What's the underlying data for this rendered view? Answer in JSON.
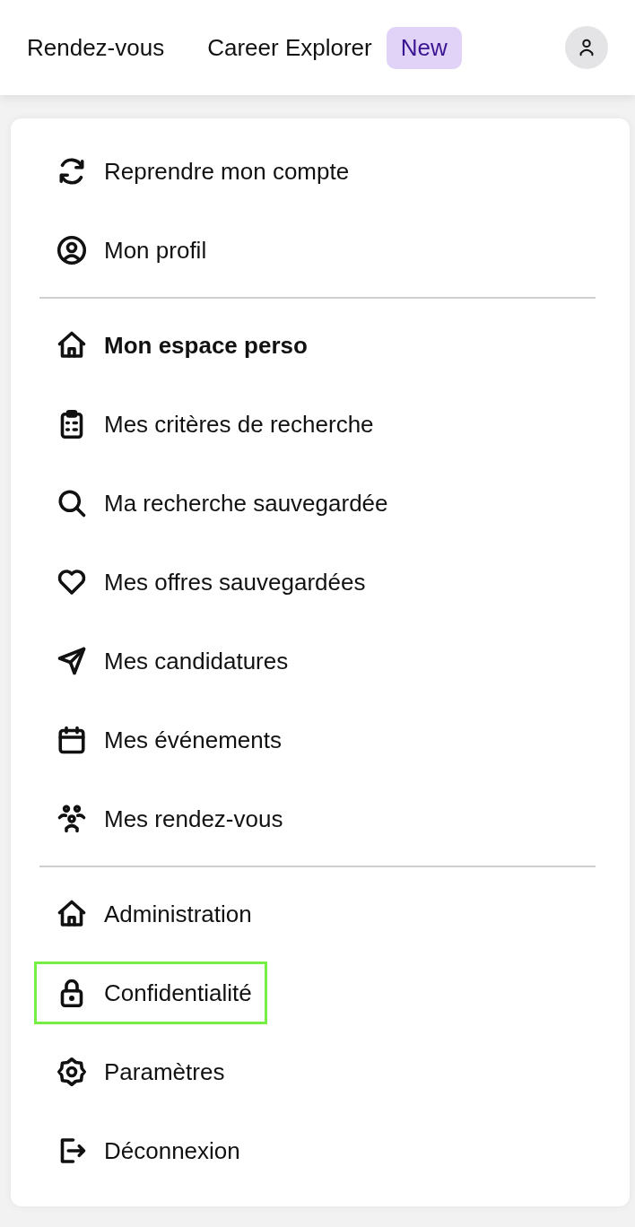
{
  "header": {
    "links": [
      {
        "label": "Rendez-vous"
      },
      {
        "label": "Career Explorer",
        "badge": "New"
      }
    ]
  },
  "menu": {
    "sections": [
      {
        "items": [
          {
            "label": "Reprendre mon compte",
            "bold": false,
            "selected": false
          },
          {
            "label": "Mon profil",
            "bold": false,
            "selected": false
          }
        ]
      },
      {
        "items": [
          {
            "label": "Mon espace perso",
            "bold": true,
            "selected": false
          },
          {
            "label": "Mes critères de recherche",
            "bold": false,
            "selected": false
          },
          {
            "label": "Ma recherche sauvegardée",
            "bold": false,
            "selected": false
          },
          {
            "label": "Mes offres sauvegardées",
            "bold": false,
            "selected": false
          },
          {
            "label": "Mes candidatures",
            "bold": false,
            "selected": false
          },
          {
            "label": "Mes événements",
            "bold": false,
            "selected": false
          },
          {
            "label": "Mes rendez-vous",
            "bold": false,
            "selected": false
          }
        ]
      },
      {
        "items": [
          {
            "label": "Administration",
            "bold": false,
            "selected": false
          },
          {
            "label": "Confidentialité",
            "bold": false,
            "selected": true
          },
          {
            "label": "Paramètres",
            "bold": false,
            "selected": false
          },
          {
            "label": "Déconnexion",
            "bold": false,
            "selected": false
          }
        ]
      }
    ]
  }
}
